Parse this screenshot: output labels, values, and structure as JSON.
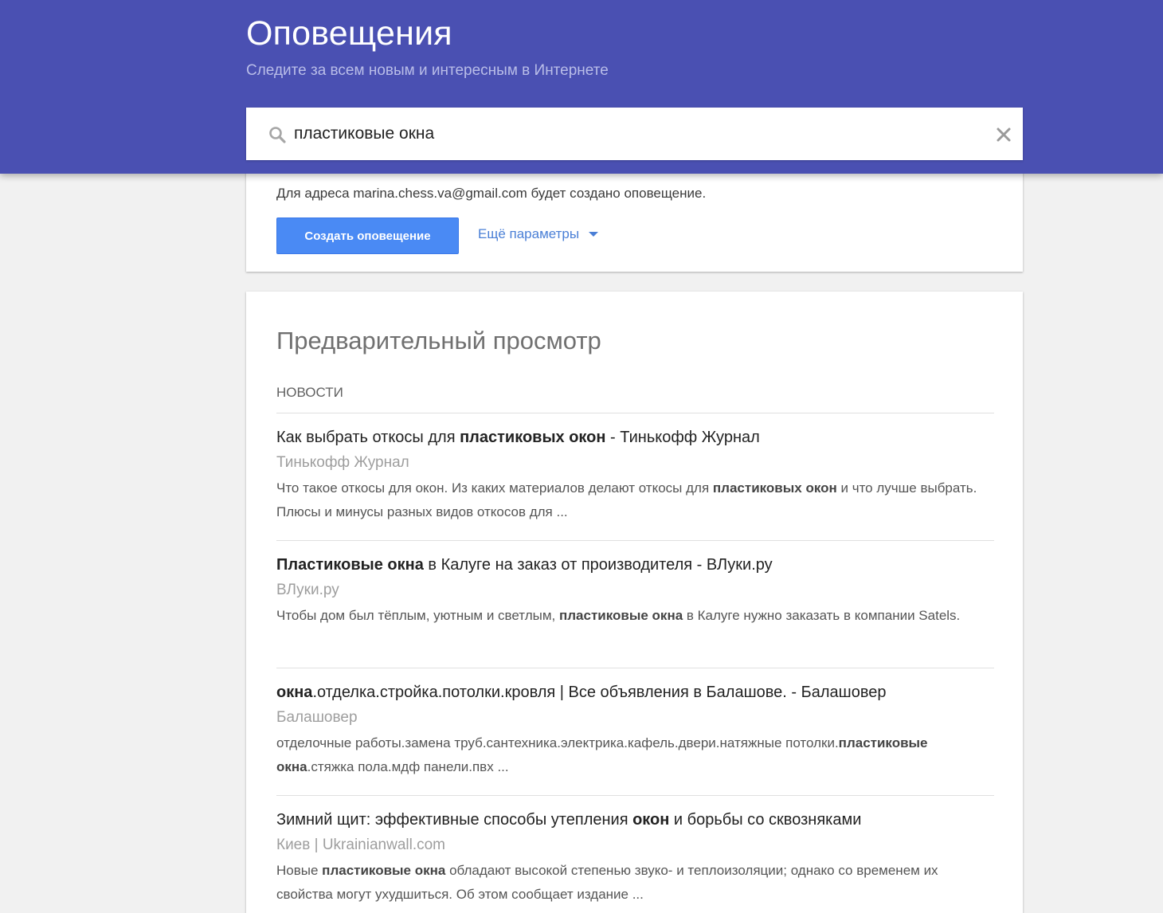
{
  "header": {
    "title": "Оповещения",
    "subtitle": "Следите за всем новым и интересным в Интернете"
  },
  "search": {
    "value": "пластиковые окна",
    "icon": "search-icon",
    "clear_icon": "close-icon"
  },
  "create_card": {
    "delivery_text": "Для адреса marina.chess.va@gmail.com будет создано оповещение.",
    "create_button": "Создать оповещение",
    "more_options": "Ещё параметры"
  },
  "preview": {
    "title": "Предварительный просмотр",
    "section": "Новости",
    "results": [
      {
        "title": [
          {
            "t": "Как выбрать откосы для "
          },
          {
            "t": "пластиковых окон",
            "b": true
          },
          {
            "t": " - Тинькофф Журнал"
          }
        ],
        "source": "Тинькофф Журнал",
        "snippet": [
          {
            "t": "Что такое откосы для окон. Из каких материалов делают откосы для "
          },
          {
            "t": "пластиковых окон",
            "b": true
          },
          {
            "t": " и что лучше выбрать. Плюсы и минусы разных видов откосов для ..."
          }
        ]
      },
      {
        "title": [
          {
            "t": "Пластиковые окна",
            "b": true
          },
          {
            "t": " в Калуге на заказ от производителя - ВЛуки.ру"
          }
        ],
        "source": "ВЛуки.ру",
        "snippet": [
          {
            "t": "Чтобы дом был тёплым, уютным и светлым, "
          },
          {
            "t": "пластиковые окна",
            "b": true
          },
          {
            "t": " в Калуге нужно заказать в компании Satels."
          }
        ]
      },
      {
        "title": [
          {
            "t": "окна",
            "b": true
          },
          {
            "t": ".отделка.стройка.потолки.кровля | Все объявления в Балашове. - Балашовер"
          }
        ],
        "source": "Балашовер",
        "snippet": [
          {
            "t": "отделочные работы.замена труб.сантехника.электрика.кафель.двери.натяжные потолки."
          },
          {
            "t": "пластиковые окна",
            "b": true
          },
          {
            "t": ".стяжка пола.мдф панели.пвх ..."
          }
        ]
      },
      {
        "title": [
          {
            "t": "Зимний щит: эффективные способы утепления "
          },
          {
            "t": "окон",
            "b": true
          },
          {
            "t": " и борьбы со сквозняками"
          }
        ],
        "source": "Киев | Ukrainianwall.com",
        "snippet": [
          {
            "t": "Новые "
          },
          {
            "t": "пластиковые окна",
            "b": true
          },
          {
            "t": " обладают высокой степенью звуко- и теплоизоляции; однако со временем их свойства могут ухудшиться. Об этом сообщает издание ..."
          }
        ]
      }
    ]
  }
}
